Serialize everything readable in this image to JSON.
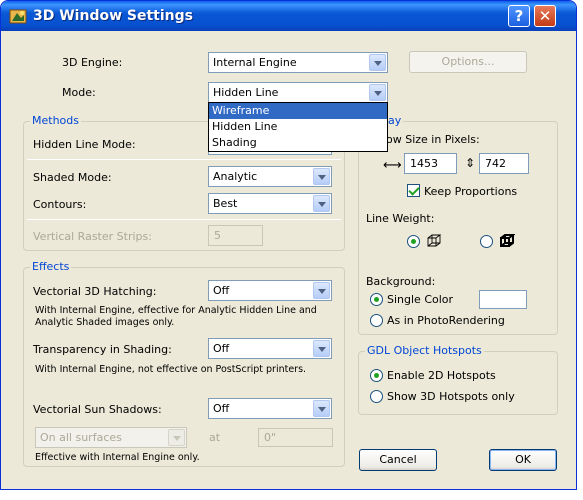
{
  "window": {
    "title": "3D Window Settings",
    "help": "?",
    "close": "✕"
  },
  "engine": {
    "label": "3D Engine:",
    "value": "Internal Engine",
    "options_button": "Options..."
  },
  "mode": {
    "label": "Mode:",
    "value": "Hidden Line",
    "dropdown": [
      "Wireframe",
      "Hidden Line",
      "Shading"
    ],
    "selected_index": 0
  },
  "methods": {
    "title": "Methods",
    "hidden_line_mode": {
      "label": "Hidden Line Mode:"
    },
    "shaded_mode": {
      "label": "Shaded Mode:",
      "value": "Analytic"
    },
    "contours": {
      "label": "Contours:",
      "value": "Best"
    },
    "raster_strips": {
      "label": "Vertical Raster Strips:",
      "value": "5"
    }
  },
  "effects": {
    "title": "Effects",
    "hatching": {
      "label": "Vectorial 3D Hatching:",
      "value": "Off",
      "note1": "With Internal Engine, effective for Analytic Hidden Line and",
      "note2": "Analytic Shaded images only."
    },
    "transparency": {
      "label": "Transparency in Shading:",
      "value": "Off",
      "note": "With Internal Engine, not effective on PostScript printers."
    },
    "sun_shadows": {
      "label": "Vectorial Sun Shadows:",
      "value": "Off"
    },
    "surfaces": {
      "value": "On all surfaces",
      "at_label": "at",
      "at_value": "0\""
    },
    "note": "Effective with Internal Engine only."
  },
  "display": {
    "title_partial": "ay",
    "size_label": "dow Size in Pixels:",
    "width_symbol": "⟷",
    "width": "1453",
    "height_symbol": "⇕",
    "height": "742",
    "keep_proportions": {
      "label": "Keep Proportions",
      "checked": true
    },
    "line_weight": {
      "label": "Line Weight:",
      "selected": "hairline"
    },
    "background": {
      "label": "Background:",
      "single_color": "Single Color",
      "as_photo": "As in PhotoRendering",
      "selected": "single_color",
      "swatch_color": "#ffffff"
    }
  },
  "gdl": {
    "title": "GDL Object Hotspots",
    "enable_2d": "Enable 2D Hotspots",
    "show_3d": "Show 3D Hotspots only",
    "selected": "enable_2d"
  },
  "footer": {
    "cancel": "Cancel",
    "ok": "OK"
  },
  "colors": {
    "title_bar": "#0a58d6",
    "group_title": "#0046d5",
    "highlight": "#316ac5",
    "check": "#21a121"
  }
}
